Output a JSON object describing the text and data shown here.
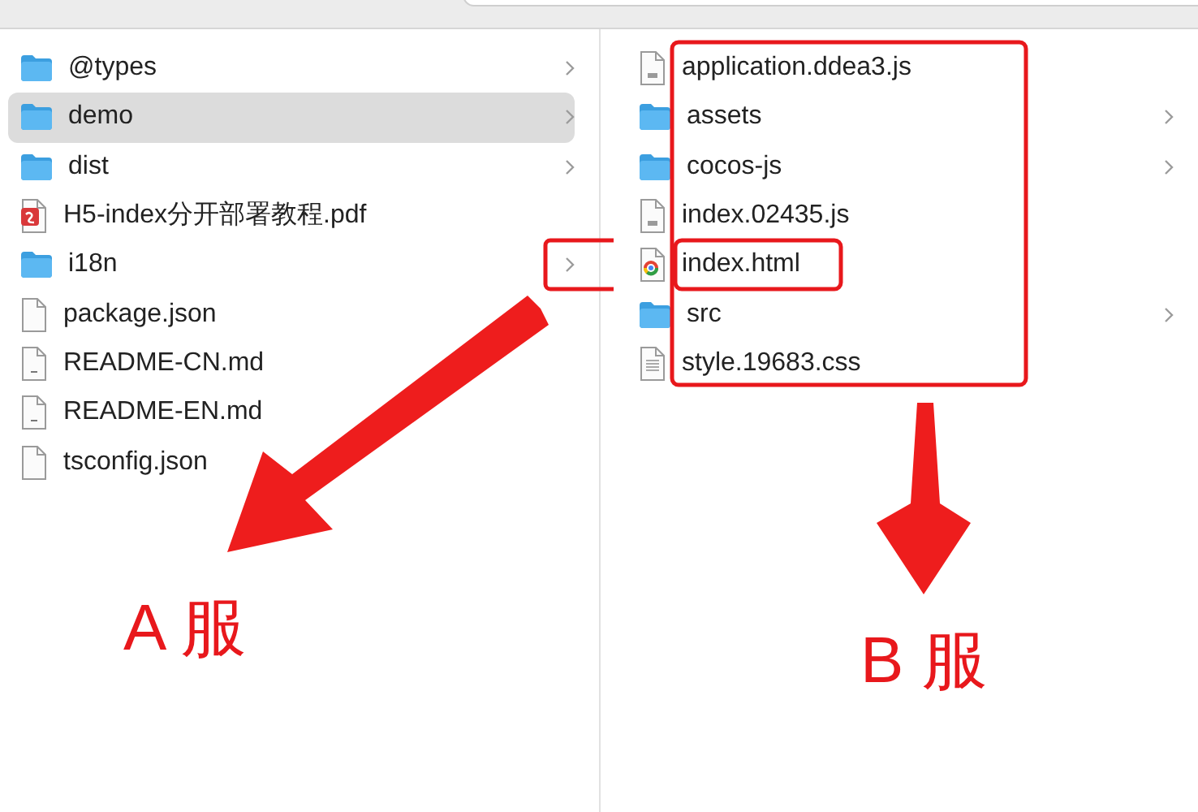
{
  "columns": [
    {
      "items": [
        {
          "name": "@types",
          "kind": "folder",
          "selected": false
        },
        {
          "name": "demo",
          "kind": "folder",
          "selected": true
        },
        {
          "name": "dist",
          "kind": "folder",
          "selected": false
        },
        {
          "name": "H5-index分开部署教程.pdf",
          "kind": "pdf",
          "selected": false
        },
        {
          "name": "i18n",
          "kind": "folder",
          "selected": false
        },
        {
          "name": "package.json",
          "kind": "file",
          "selected": false
        },
        {
          "name": "README-CN.md",
          "kind": "text",
          "selected": false
        },
        {
          "name": "README-EN.md",
          "kind": "text",
          "selected": false
        },
        {
          "name": "tsconfig.json",
          "kind": "file",
          "selected": false
        }
      ]
    },
    {
      "items": [
        {
          "name": "application.ddea3.js",
          "kind": "script",
          "selected": false
        },
        {
          "name": "assets",
          "kind": "folder",
          "selected": false
        },
        {
          "name": "cocos-js",
          "kind": "folder",
          "selected": false
        },
        {
          "name": "index.02435.js",
          "kind": "script",
          "selected": false
        },
        {
          "name": "index.html",
          "kind": "html",
          "selected": false
        },
        {
          "name": "src",
          "kind": "folder",
          "selected": false
        },
        {
          "name": "style.19683.css",
          "kind": "stylesheet",
          "selected": false
        }
      ]
    }
  ],
  "annotations": {
    "labels": [
      "A 服",
      "B 服"
    ]
  }
}
